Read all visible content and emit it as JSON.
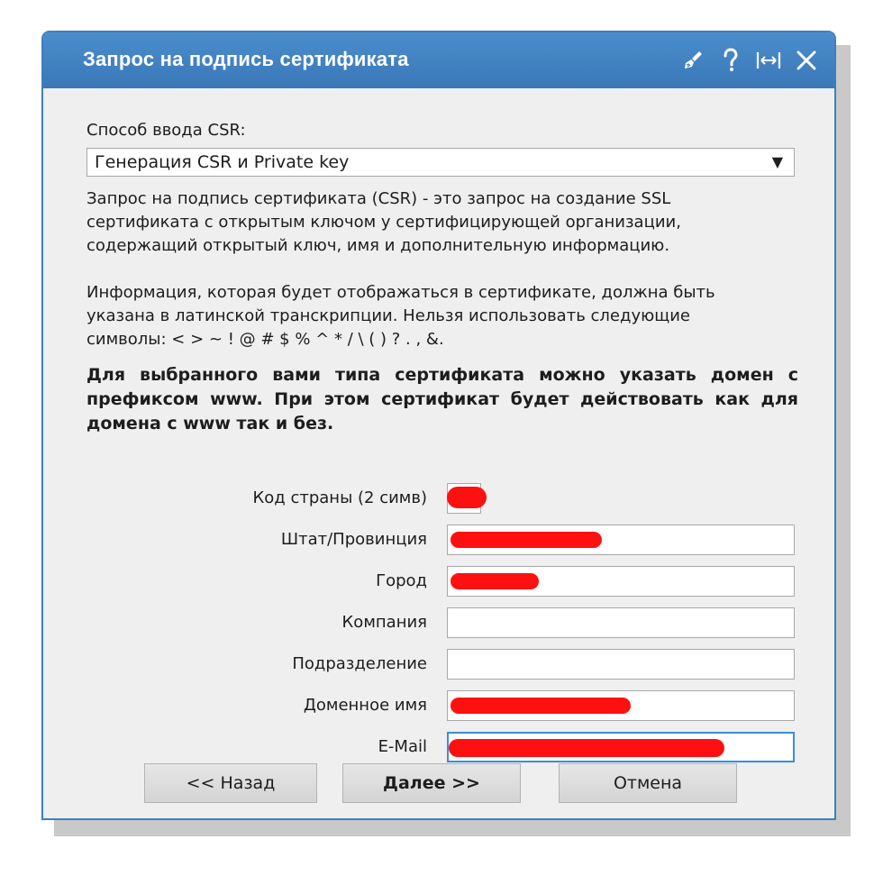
{
  "dialog": {
    "title": "Запрос на подпись сертификата",
    "icons": [
      "broom-icon",
      "help-icon",
      "resize-icon",
      "close-icon"
    ]
  },
  "csr_method": {
    "label": "Способ ввода CSR:",
    "selected": "Генерация CSR и Private key",
    "arrow": "▼"
  },
  "description": {
    "line1": "Запрос на подпись сертификата (CSR) - это запрос на создание SSL",
    "line2": "сертификата с открытым ключом у сертифицирующей организации,",
    "line3": "содержащий открытый ключ, имя и дополнительную информацию."
  },
  "info": {
    "line1": "Информация, которая будет отображаться в сертификате, должна быть",
    "line2": "указана в латинской транскрипции. Нельзя использовать следующие",
    "line3": "символы: < > ~ ! @ # $ % ^ * / \\ ( ) ? . , &."
  },
  "notice": {
    "text": "Для выбранного вами типа сертификата можно указать домен с префиксом www. При этом сертификат будет действовать как для домена с www так и без."
  },
  "fields": [
    {
      "label": "Код страны (2 симв)",
      "value": ""
    },
    {
      "label": "Штат/Провинция",
      "value": ""
    },
    {
      "label": "Город",
      "value": ""
    },
    {
      "label": "Компания",
      "value": ""
    },
    {
      "label": "Подразделение",
      "value": ""
    },
    {
      "label": "Доменное имя",
      "value": ""
    },
    {
      "label": "E-Mail",
      "value": ""
    }
  ],
  "buttons": {
    "back": "<< Назад",
    "next": "Далее >>",
    "cancel": "Отмена"
  },
  "colors": {
    "titlebar": "#3a78b8",
    "redaction": "#ff1010",
    "focus": "#3c8ddb"
  }
}
